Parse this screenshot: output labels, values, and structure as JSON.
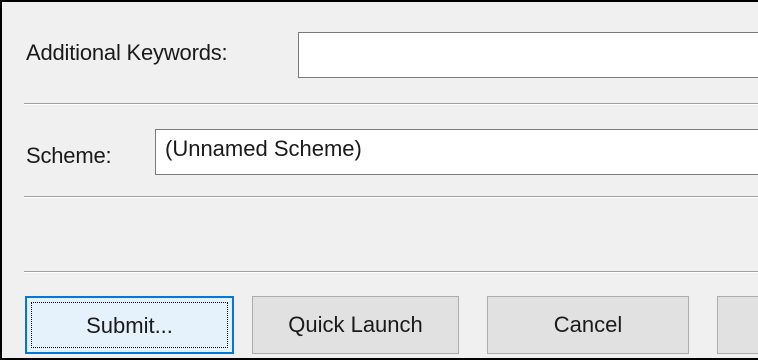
{
  "fields": {
    "additional_keywords": {
      "label": "Additional Keywords:",
      "value": ""
    },
    "scheme": {
      "label": "Scheme:",
      "value": "(Unnamed Scheme)"
    }
  },
  "buttons": {
    "submit": "Submit...",
    "quick_launch": "Quick Launch",
    "cancel": "Cancel",
    "fourth": ""
  },
  "colors": {
    "dialog_background": "#f0f0f0",
    "default_button_border": "#0078d7",
    "button_background": "#e1e1e1"
  }
}
